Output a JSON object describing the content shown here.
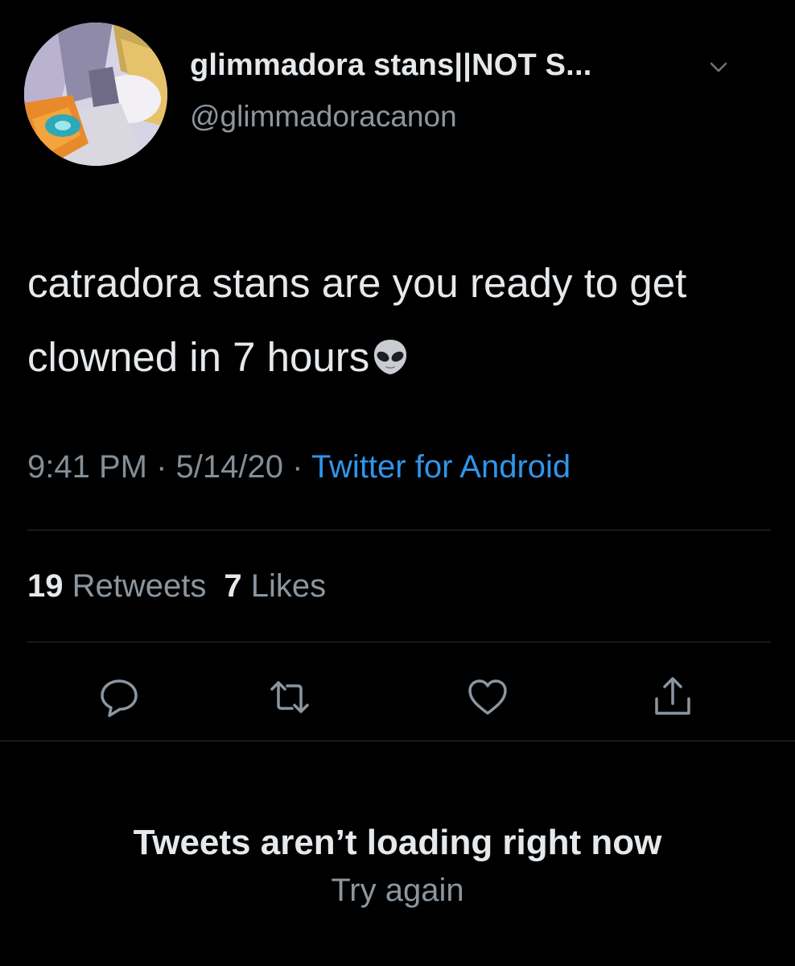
{
  "tweet": {
    "author": {
      "display_name": "glimmadora stans||NOT S...",
      "handle": "@glimmadoracanon"
    },
    "text": "catradora stans are you ready to get clowned in 7 hours",
    "emoji": "alien-icon",
    "time": "9:41 PM",
    "separator": " · ",
    "date": "5/14/20",
    "source": "Twitter for Android",
    "stats": {
      "retweets_count": "19",
      "retweets_label": "Retweets",
      "likes_count": "7",
      "likes_label": "Likes"
    },
    "actions": [
      "reply-icon",
      "retweet-icon",
      "like-icon",
      "share-icon"
    ]
  },
  "error": {
    "title": "Tweets aren’t loading right now",
    "retry_label": "Try again"
  },
  "colors": {
    "background": "#000000",
    "text": "#e6e9ec",
    "secondary": "#8b969f",
    "link": "#2f95ea"
  }
}
